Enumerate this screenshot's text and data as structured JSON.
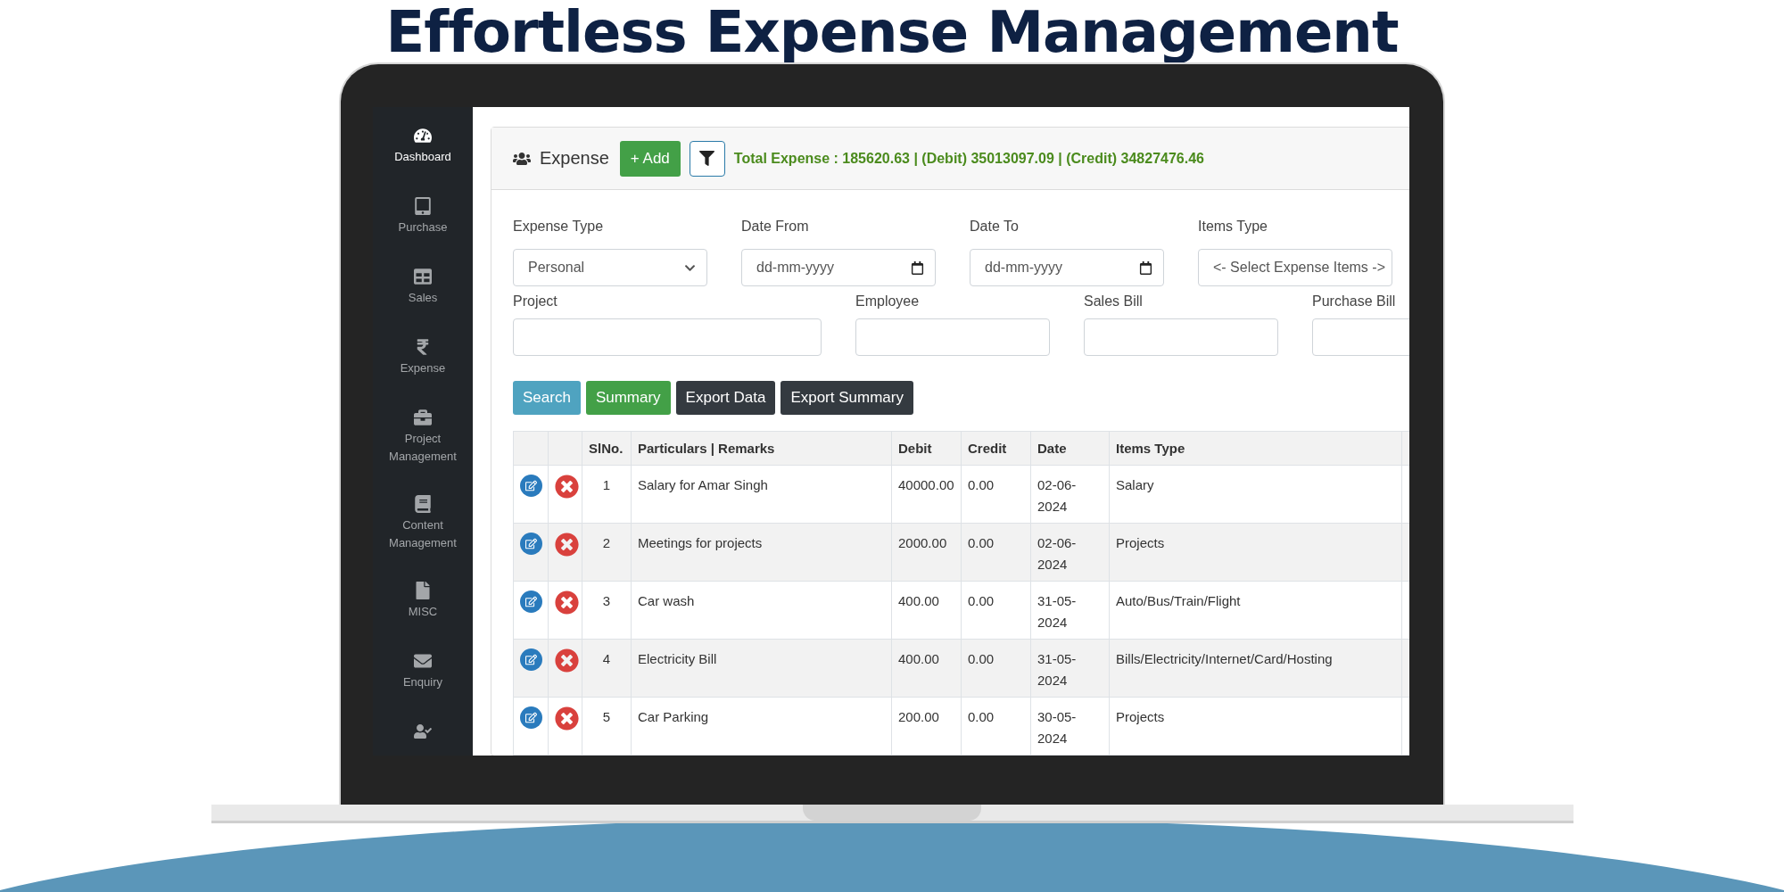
{
  "headline": "Effortless Expense Management",
  "sidebar": {
    "items": [
      {
        "label": "Dashboard",
        "selected": true
      },
      {
        "label": "Purchase",
        "selected": false
      },
      {
        "label": "Sales",
        "selected": false
      },
      {
        "label": "Expense",
        "selected": false
      },
      {
        "label": "Project Management",
        "selected": false
      },
      {
        "label": "Content Management",
        "selected": false
      },
      {
        "label": "MISC",
        "selected": false
      },
      {
        "label": "Enquiry",
        "selected": false
      }
    ]
  },
  "panel": {
    "title": "Expense",
    "add_button": "+ Add",
    "total": "Total Expense : 185620.63 | (Debit) 35013097.09 | (Credit) 34827476.46"
  },
  "filters": [
    {
      "label": "Expense Type",
      "kind": "select",
      "value": "Personal"
    },
    {
      "label": "Date From",
      "kind": "date",
      "placeholder": "dd-mm-yyyy"
    },
    {
      "label": "Date To",
      "kind": "date",
      "placeholder": "dd-mm-yyyy"
    },
    {
      "label": "Items Type",
      "kind": "select",
      "value": "<- Select Expense Items ->"
    }
  ],
  "filters_row_2": [
    {
      "label": "Project",
      "kind": "text"
    },
    {
      "label": "Employee",
      "kind": "text"
    },
    {
      "label": "Sales Bill",
      "kind": "text"
    },
    {
      "label": "Purchase Bill",
      "kind": "text"
    }
  ],
  "buttons": [
    {
      "label": "Search",
      "kind": "info"
    },
    {
      "label": "Summary",
      "kind": "success"
    },
    {
      "label": "Export Data",
      "kind": "dark"
    },
    {
      "label": "Export Summary",
      "kind": "dark"
    }
  ],
  "table": {
    "columns": [
      "SlNo.",
      "Particulars | Remarks",
      "Debit",
      "Credit",
      "Date",
      "Items Type"
    ],
    "rows": [
      {
        "sl": "1",
        "particulars": "Salary for Amar Singh",
        "debit": "40000.00",
        "credit": "0.00",
        "date": "02-06-2024",
        "items_type": "Salary"
      },
      {
        "sl": "2",
        "particulars": "Meetings for projects",
        "debit": "2000.00",
        "credit": "0.00",
        "date": "02-06-2024",
        "items_type": "Projects"
      },
      {
        "sl": "3",
        "particulars": "Car wash",
        "debit": "400.00",
        "credit": "0.00",
        "date": "31-05-2024",
        "items_type": "Auto/Bus/Train/Flight"
      },
      {
        "sl": "4",
        "particulars": "Electricity Bill",
        "debit": "400.00",
        "credit": "0.00",
        "date": "31-05-2024",
        "items_type": "Bills/Electricity/Internet/Card/Hosting"
      },
      {
        "sl": "5",
        "particulars": "Car Parking",
        "debit": "200.00",
        "credit": "0.00",
        "date": "30-05-2024",
        "items_type": "Projects"
      }
    ]
  }
}
